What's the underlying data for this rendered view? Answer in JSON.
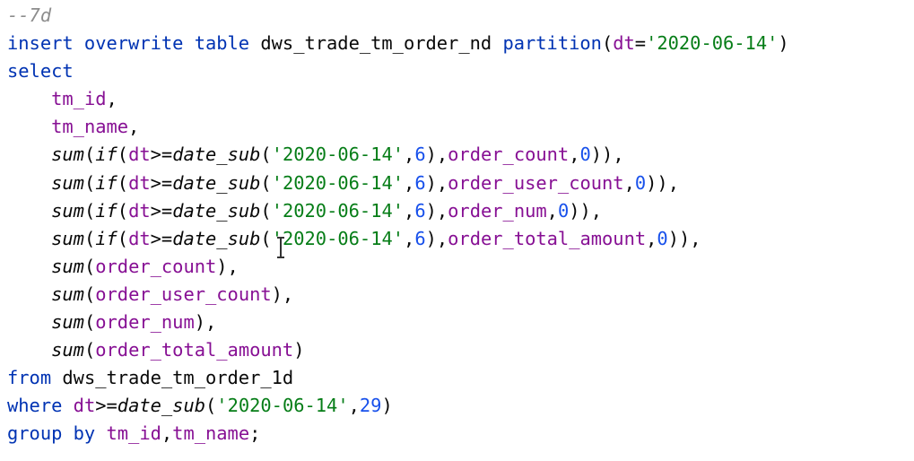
{
  "editor": {
    "lines": [
      [
        {
          "t": "--7d",
          "c": "cmt"
        }
      ],
      [
        {
          "t": "insert overwrite table ",
          "c": "kw"
        },
        {
          "t": "dws_trade_tm_order_nd ",
          "c": "tbl"
        },
        {
          "t": "partition",
          "c": "kw"
        },
        {
          "t": "(",
          "c": "pun"
        },
        {
          "t": "dt",
          "c": "col"
        },
        {
          "t": "=",
          "c": "pun"
        },
        {
          "t": "'2020-06-14'",
          "c": "str"
        },
        {
          "t": ")",
          "c": "pun"
        }
      ],
      [
        {
          "t": "select",
          "c": "kw"
        }
      ],
      [
        {
          "t": "    ",
          "c": "pun"
        },
        {
          "t": "tm_id",
          "c": "id"
        },
        {
          "t": ",",
          "c": "pun"
        }
      ],
      [
        {
          "t": "    ",
          "c": "pun"
        },
        {
          "t": "tm_name",
          "c": "id"
        },
        {
          "t": ",",
          "c": "pun"
        }
      ],
      [
        {
          "t": "    ",
          "c": "pun"
        },
        {
          "t": "sum",
          "c": "fn"
        },
        {
          "t": "(",
          "c": "pun"
        },
        {
          "t": "if",
          "c": "fn"
        },
        {
          "t": "(",
          "c": "pun"
        },
        {
          "t": "dt",
          "c": "col"
        },
        {
          "t": ">=",
          "c": "pun"
        },
        {
          "t": "date_sub",
          "c": "fn"
        },
        {
          "t": "(",
          "c": "pun"
        },
        {
          "t": "'2020-06-14'",
          "c": "str"
        },
        {
          "t": ",",
          "c": "pun"
        },
        {
          "t": "6",
          "c": "num"
        },
        {
          "t": "),",
          "c": "pun"
        },
        {
          "t": "order_count",
          "c": "col"
        },
        {
          "t": ",",
          "c": "pun"
        },
        {
          "t": "0",
          "c": "num"
        },
        {
          "t": ")),",
          "c": "pun"
        }
      ],
      [
        {
          "t": "    ",
          "c": "pun"
        },
        {
          "t": "sum",
          "c": "fn"
        },
        {
          "t": "(",
          "c": "pun"
        },
        {
          "t": "if",
          "c": "fn"
        },
        {
          "t": "(",
          "c": "pun"
        },
        {
          "t": "dt",
          "c": "col"
        },
        {
          "t": ">=",
          "c": "pun"
        },
        {
          "t": "date_sub",
          "c": "fn"
        },
        {
          "t": "(",
          "c": "pun"
        },
        {
          "t": "'2020-06-14'",
          "c": "str"
        },
        {
          "t": ",",
          "c": "pun"
        },
        {
          "t": "6",
          "c": "num"
        },
        {
          "t": "),",
          "c": "pun"
        },
        {
          "t": "order_user_count",
          "c": "col"
        },
        {
          "t": ",",
          "c": "pun"
        },
        {
          "t": "0",
          "c": "num"
        },
        {
          "t": ")),",
          "c": "pun"
        }
      ],
      [
        {
          "t": "    ",
          "c": "pun"
        },
        {
          "t": "sum",
          "c": "fn"
        },
        {
          "t": "(",
          "c": "pun"
        },
        {
          "t": "if",
          "c": "fn"
        },
        {
          "t": "(",
          "c": "pun"
        },
        {
          "t": "dt",
          "c": "col"
        },
        {
          "t": ">=",
          "c": "pun"
        },
        {
          "t": "date_sub",
          "c": "fn"
        },
        {
          "t": "(",
          "c": "pun"
        },
        {
          "t": "'2020-06-14'",
          "c": "str"
        },
        {
          "t": ",",
          "c": "pun"
        },
        {
          "t": "6",
          "c": "num"
        },
        {
          "t": "),",
          "c": "pun"
        },
        {
          "t": "order_num",
          "c": "col"
        },
        {
          "t": ",",
          "c": "pun"
        },
        {
          "t": "0",
          "c": "num"
        },
        {
          "t": ")),",
          "c": "pun"
        }
      ],
      [
        {
          "t": "    ",
          "c": "pun"
        },
        {
          "t": "sum",
          "c": "fn"
        },
        {
          "t": "(",
          "c": "pun"
        },
        {
          "t": "if",
          "c": "fn"
        },
        {
          "t": "(",
          "c": "pun"
        },
        {
          "t": "dt",
          "c": "col"
        },
        {
          "t": ">=",
          "c": "pun"
        },
        {
          "t": "date_sub",
          "c": "fn"
        },
        {
          "t": "(",
          "c": "pun"
        },
        {
          "t": "'2020-06-14'",
          "c": "str"
        },
        {
          "t": ",",
          "c": "pun"
        },
        {
          "t": "6",
          "c": "num"
        },
        {
          "t": "),",
          "c": "pun"
        },
        {
          "t": "order_total_amount",
          "c": "col"
        },
        {
          "t": ",",
          "c": "pun"
        },
        {
          "t": "0",
          "c": "num"
        },
        {
          "t": ")),",
          "c": "pun"
        }
      ],
      [
        {
          "t": "    ",
          "c": "pun"
        },
        {
          "t": "sum",
          "c": "fn"
        },
        {
          "t": "(",
          "c": "pun"
        },
        {
          "t": "order_count",
          "c": "col"
        },
        {
          "t": "),",
          "c": "pun"
        }
      ],
      [
        {
          "t": "    ",
          "c": "pun"
        },
        {
          "t": "sum",
          "c": "fn"
        },
        {
          "t": "(",
          "c": "pun"
        },
        {
          "t": "order_user_count",
          "c": "col"
        },
        {
          "t": "),",
          "c": "pun"
        }
      ],
      [
        {
          "t": "    ",
          "c": "pun"
        },
        {
          "t": "sum",
          "c": "fn"
        },
        {
          "t": "(",
          "c": "pun"
        },
        {
          "t": "order_num",
          "c": "col"
        },
        {
          "t": "),",
          "c": "pun"
        }
      ],
      [
        {
          "t": "    ",
          "c": "pun"
        },
        {
          "t": "sum",
          "c": "fn"
        },
        {
          "t": "(",
          "c": "pun"
        },
        {
          "t": "order_total_amount",
          "c": "col"
        },
        {
          "t": ")",
          "c": "pun"
        }
      ],
      [
        {
          "t": "from ",
          "c": "kw"
        },
        {
          "t": "dws_trade_tm_order_1d",
          "c": "tbl"
        }
      ],
      [
        {
          "t": "where ",
          "c": "kw"
        },
        {
          "t": "dt",
          "c": "col"
        },
        {
          "t": ">=",
          "c": "pun"
        },
        {
          "t": "date_sub",
          "c": "fn"
        },
        {
          "t": "(",
          "c": "pun"
        },
        {
          "t": "'2020-06-14'",
          "c": "str"
        },
        {
          "t": ",",
          "c": "pun"
        },
        {
          "t": "29",
          "c": "num"
        },
        {
          "t": ")",
          "c": "pun"
        }
      ],
      [
        {
          "t": "group by ",
          "c": "kw"
        },
        {
          "t": "tm_id",
          "c": "id"
        },
        {
          "t": ",",
          "c": "pun"
        },
        {
          "t": "tm_name",
          "c": "id"
        },
        {
          "t": ";",
          "c": "pun"
        }
      ]
    ]
  }
}
